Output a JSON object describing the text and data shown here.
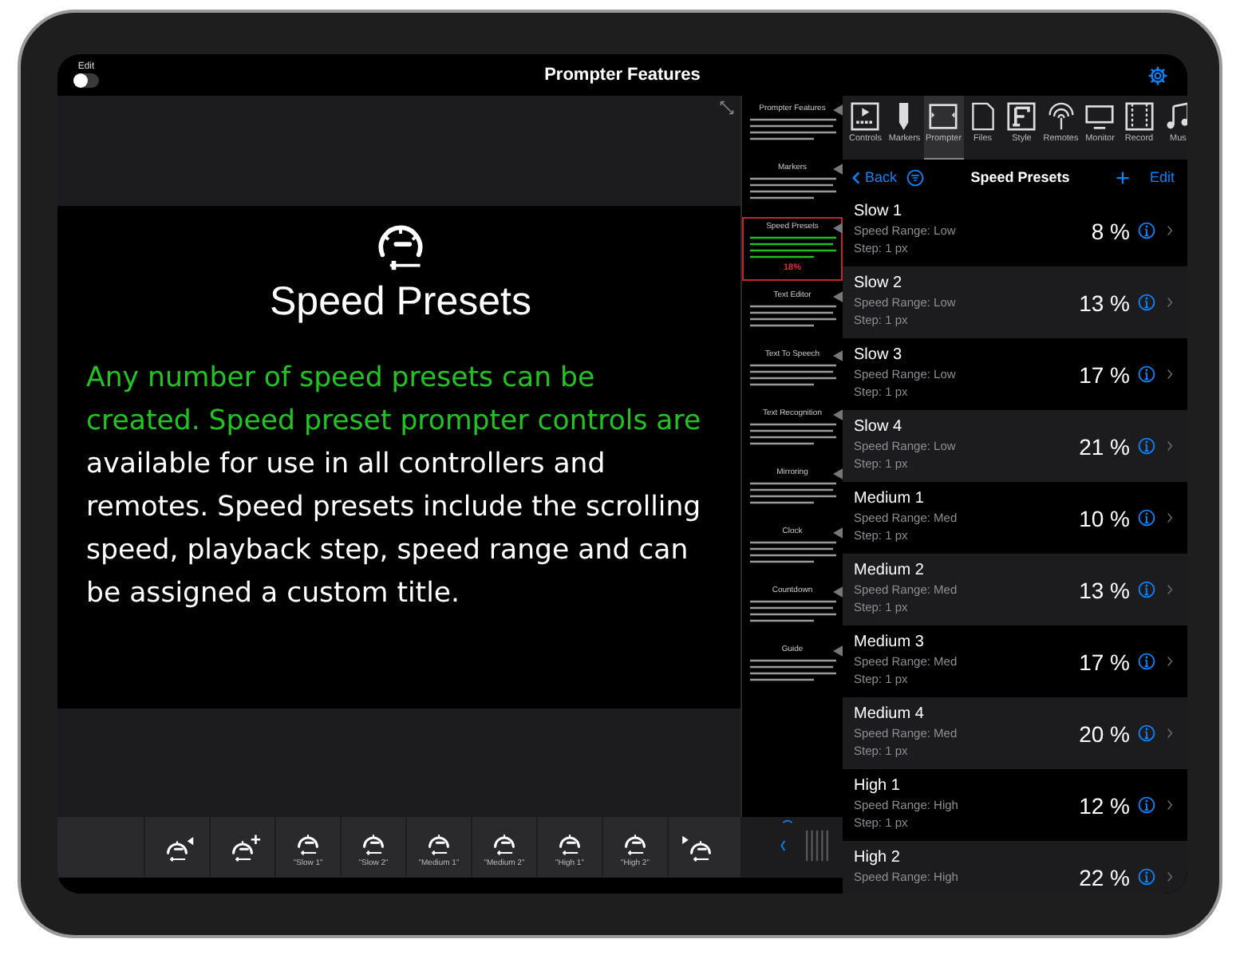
{
  "top_bar": {
    "edit_label": "Edit",
    "edit_toggle": {
      "on": false
    },
    "title": "Prompter Features"
  },
  "stage": {
    "heading": "Speed Presets",
    "paragraph": {
      "highlighted": "Any number of speed presets can be created. Speed preset prompter controls are",
      "rest": "available for use in all controllers and remotes. Speed presets include the scrolling speed, playback step, speed range and can be assigned a custom title."
    }
  },
  "script_preview": [
    {
      "heading": "Prompter Features",
      "selected": false
    },
    {
      "heading": "Markers",
      "selected": false
    },
    {
      "heading": "Speed Presets",
      "selected": true,
      "reading": "18%"
    },
    {
      "heading": "Text Editor",
      "selected": false
    },
    {
      "heading": "Text To Speech",
      "selected": false
    },
    {
      "heading": "Text Recognition",
      "selected": false
    },
    {
      "heading": "Mirroring",
      "selected": false
    },
    {
      "heading": "Clock",
      "selected": false
    },
    {
      "heading": "Countdown",
      "selected": false
    },
    {
      "heading": "Guide",
      "selected": false
    }
  ],
  "bottom_toolbar": [
    {
      "kind": "back"
    },
    {
      "kind": "add"
    },
    {
      "kind": "preset",
      "caption": "\"Slow 1\""
    },
    {
      "kind": "preset",
      "caption": "\"Slow 2\""
    },
    {
      "kind": "preset",
      "caption": "\"Medium 1\""
    },
    {
      "kind": "preset",
      "caption": "\"Medium 2\""
    },
    {
      "kind": "preset",
      "caption": "\"High 1\""
    },
    {
      "kind": "preset",
      "caption": "\"High 2\""
    },
    {
      "kind": "forward"
    }
  ],
  "tabs": [
    {
      "label": "Controls",
      "kind": "controls",
      "selected": false
    },
    {
      "label": "Markers",
      "kind": "markers",
      "selected": false
    },
    {
      "label": "Prompter",
      "kind": "prompter",
      "selected": true
    },
    {
      "label": "Files",
      "kind": "files",
      "selected": false
    },
    {
      "label": "Style",
      "kind": "style",
      "selected": false
    },
    {
      "label": "Remotes",
      "kind": "remotes",
      "selected": false
    },
    {
      "label": "Monitor",
      "kind": "monitor",
      "selected": false
    },
    {
      "label": "Record",
      "kind": "record",
      "selected": false
    },
    {
      "label": "Mus",
      "kind": "music",
      "selected": false
    }
  ],
  "nav": {
    "back": "Back",
    "title": "Speed Presets",
    "edit": "Edit"
  },
  "presets": [
    {
      "name": "Slow 1",
      "range": "Speed Range: Low",
      "step": "Step: 1 px",
      "speed": "8 %"
    },
    {
      "name": "Slow 2",
      "range": "Speed Range: Low",
      "step": "Step: 1 px",
      "speed": "13 %"
    },
    {
      "name": "Slow 3",
      "range": "Speed Range: Low",
      "step": "Step: 1 px",
      "speed": "17 %"
    },
    {
      "name": "Slow 4",
      "range": "Speed Range: Low",
      "step": "Step: 1 px",
      "speed": "21 %"
    },
    {
      "name": "Medium 1",
      "range": "Speed Range: Med",
      "step": "Step: 1 px",
      "speed": "10 %"
    },
    {
      "name": "Medium 2",
      "range": "Speed Range: Med",
      "step": "Step: 1 px",
      "speed": "13 %"
    },
    {
      "name": "Medium 3",
      "range": "Speed Range: Med",
      "step": "Step: 1 px",
      "speed": "17 %"
    },
    {
      "name": "Medium 4",
      "range": "Speed Range: Med",
      "step": "Step: 1 px",
      "speed": "20 %"
    },
    {
      "name": "High 1",
      "range": "Speed Range: High",
      "step": "Step: 1 px",
      "speed": "12 %"
    },
    {
      "name": "High 2",
      "range": "Speed Range: High",
      "speed": "22 %"
    }
  ]
}
